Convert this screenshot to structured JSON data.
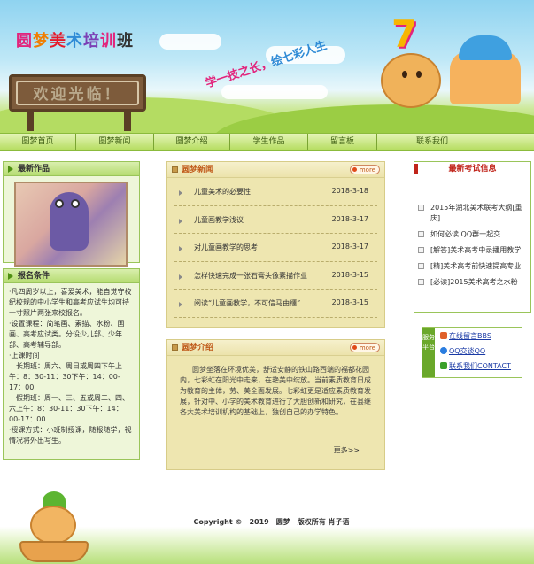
{
  "header": {
    "logo_chars": [
      "圆",
      "梦",
      "美",
      "术",
      "培",
      "训",
      "班"
    ],
    "slogan_part1": "学一技之长，",
    "slogan_part2": "绘七彩人生",
    "welcome_sign": "欢迎光临！",
    "balloon_number": "7"
  },
  "nav": {
    "items": [
      "圆梦首页",
      "圆梦新闻",
      "圆梦介绍",
      "学生作品",
      "留言板",
      "联系我们"
    ]
  },
  "latest_works": {
    "title": "最新作品"
  },
  "application": {
    "title": "报名条件",
    "lines": [
      "·凡四周岁以上，喜爱美术，能自觉守校纪校规的中小学生和高考应试生均可持一寸照片两张来校报名。",
      "·设置课程：简笔画、素描、水粉、国画、高考应试类。分设少儿部、少年部、高考辅导部。",
      "·上课时间",
      "　长期班：周六、周日或周四下午上午：8：30-11：30下午：14：00-17：00",
      "　假期班：周一、三、五或周二、四、六上午：8：30-11：30下午：14：00-17：00",
      "·授课方式：小班制授课，随报随学，视情况将外出写生。"
    ]
  },
  "news": {
    "title": "圆梦新闻",
    "more_label": "more",
    "items": [
      {
        "title": "儿童美术的必要性",
        "date": "2018-3-18"
      },
      {
        "title": "儿童画教学浅议",
        "date": "2018-3-17"
      },
      {
        "title": "对儿童画教学的思考",
        "date": "2018-3-17"
      },
      {
        "title": "怎样快速完成一张石膏头像素描作业",
        "date": "2018-3-15"
      },
      {
        "title": "阅读“儿童画教学，不可信马由缰”",
        "date": "2018-3-15"
      }
    ]
  },
  "intro": {
    "title": "圆梦介绍",
    "more_label": "more",
    "text": "圆梦坐落在环境优美，舒适安静的铁山路西端的福都花园内，七彩虹在阳光中走来，在艳美中绽放。当前素质教育日成为教育的主体，劳、美全面发展。七彩虹更是适应素质教育发展，针对中、小学的美术教育进行了大胆创新和研究，在县继各大美术培训机构的基础上，独创自己的办学特色。",
    "read_more": "……更多>>"
  },
  "exam": {
    "title": "最新考试信息",
    "items": [
      "2015年湖北美术联考大纲[重庆]",
      "如何必读 QQ群一起交",
      "[解答]美术高考中录播用教学",
      "[精]美术高考前快速提高专业",
      "[必读]2015美术高考之水粉"
    ]
  },
  "service": {
    "side_label": "服务平台",
    "links": [
      {
        "label": "在线留言BBS",
        "icon": "chat-icon",
        "color": "#e0602a"
      },
      {
        "label": "QQ交谈QQ",
        "icon": "qq-penguin-icon",
        "color": "#2a7de0"
      },
      {
        "label": "联系我们CONTACT",
        "icon": "contact-icon",
        "color": "#3aa02a"
      }
    ]
  },
  "footer": {
    "copyright": "Copyright ©　2019　圆梦　版权所有 肖子语"
  },
  "colors": {
    "nav_green": "#b7de63",
    "panel_border": "#9ac55a",
    "news_title": "#c05a1a",
    "exam_title": "#c0241a"
  }
}
